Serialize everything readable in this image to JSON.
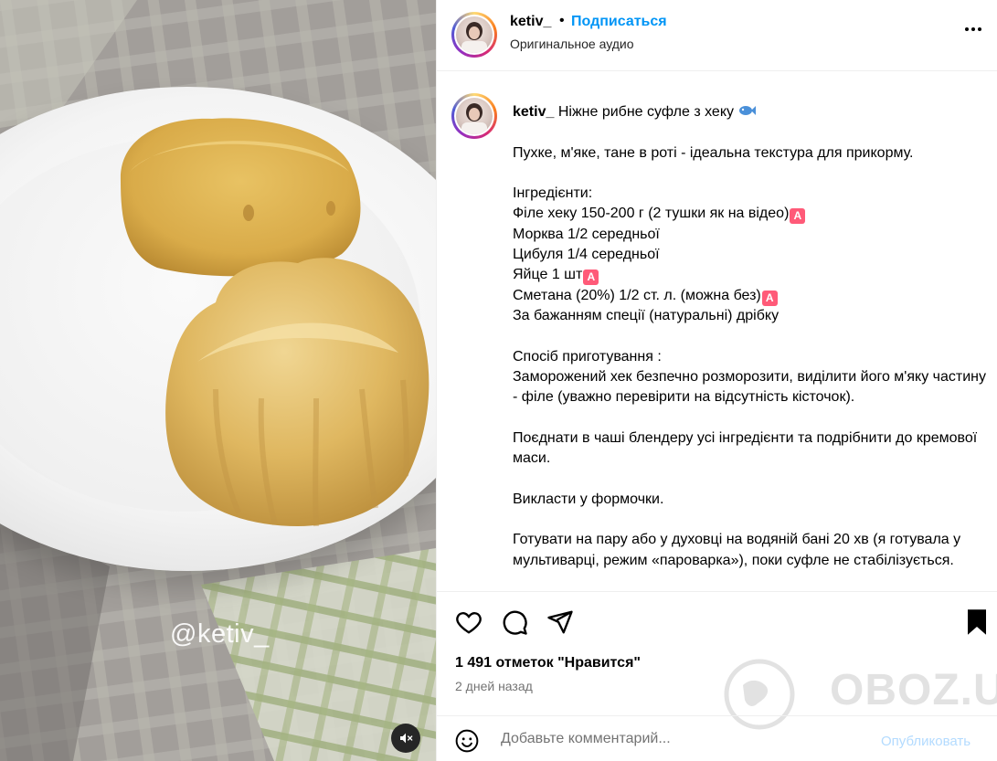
{
  "media": {
    "watermark": "@ketiv_",
    "mute_icon": "speaker-muted-icon"
  },
  "header": {
    "username": "ketiv_",
    "separator": "•",
    "follow_label": "Подписаться",
    "audio_label": "Оригинальное аудио",
    "more_icon": "more-dots-icon"
  },
  "caption": {
    "username": "ketiv_",
    "title": "Ніжне рибне суфле з хеку",
    "intro": "Пухке, м'яке, тане в роті - ідеальна текстура для прикорму.",
    "ingredients_heading": "Інгредієнти:",
    "ingredient_1": "Філе хеку 150-200 г (2 тушки як на відео)",
    "ingredient_2": "Морква 1/2 середньої",
    "ingredient_3": "Цибуля 1/4 середньої",
    "ingredient_4": "Яйце 1 шт",
    "ingredient_5": "Сметана (20%) 1/2 ст. л. (можна без)",
    "ingredient_6": "За бажанням спеції (натуральні) дрібку",
    "method_heading": "Спосіб приготування :",
    "step_1": "Заморожений хек безпечно розморозити, виділити його м'яку частину - філе (уважно перевірити на відсутність кісточок).",
    "step_2": "Поєднати в чаші блендеру усі інгредієнти та подрібнити до кремової маси.",
    "step_3": "Викласти у формочки.",
    "step_4": "Готувати на пару або у духовці на водяній бані 20 хв (я готувала у мультиварці, режим «пароварка»), поки суфле не стабілізується.",
    "warn_glyph": "A"
  },
  "actions": {
    "like_icon": "heart-icon",
    "comment_icon": "comment-icon",
    "share_icon": "share-icon",
    "save_icon": "bookmark-icon"
  },
  "likes": "1 491 отметок \"Нравится\"",
  "timestamp": "2 дней назад",
  "comment": {
    "placeholder": "Добавьте комментарий...",
    "publish_label": "Опубликовать",
    "emoji_icon": "smiley-icon"
  },
  "site_watermark": "OBOZ.UA"
}
